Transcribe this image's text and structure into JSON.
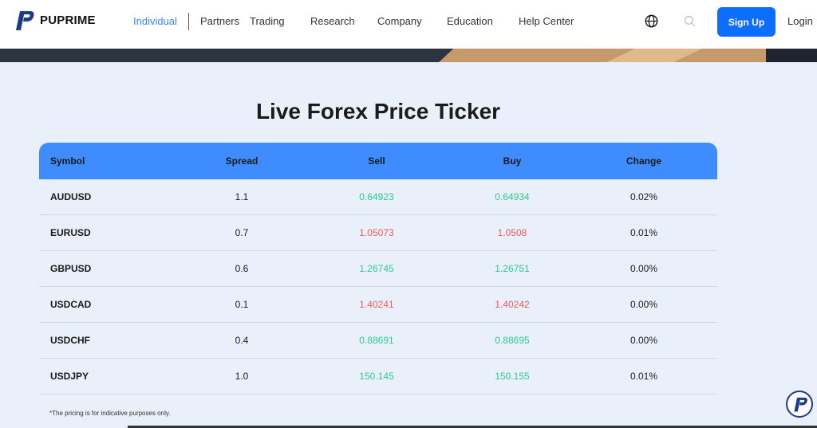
{
  "nav": {
    "brand": "PUPRIME",
    "links": [
      "Individual",
      "Partners",
      "Trading",
      "Research",
      "Company",
      "Education",
      "Help Center"
    ],
    "signup": "Sign Up",
    "login": "Login"
  },
  "colors": {
    "accent": "#0d6efd",
    "header": "#3f8cff",
    "up": "#2ec990",
    "down": "#ef5a5a",
    "background": "#e9f0fa"
  },
  "page": {
    "title": "Live Forex Price Ticker",
    "note": "*The pricing is for indicative purposes only."
  },
  "table": {
    "headers": {
      "symbol": "Symbol",
      "spread": "Spread",
      "sell": "Sell",
      "buy": "Buy",
      "change": "Change"
    },
    "rows": [
      {
        "symbol": "AUDUSD",
        "spread": "1.1",
        "sell": "0.64923",
        "buy": "0.64934",
        "change": "0.02%",
        "direction": "up"
      },
      {
        "symbol": "EURUSD",
        "spread": "0.7",
        "sell": "1.05073",
        "buy": "1.0508",
        "change": "0.01%",
        "direction": "down"
      },
      {
        "symbol": "GBPUSD",
        "spread": "0.6",
        "sell": "1.26745",
        "buy": "1.26751",
        "change": "0.00%",
        "direction": "up"
      },
      {
        "symbol": "USDCAD",
        "spread": "0.1",
        "sell": "1.40241",
        "buy": "1.40242",
        "change": "0.00%",
        "direction": "down"
      },
      {
        "symbol": "USDCHF",
        "spread": "0.4",
        "sell": "0.88691",
        "buy": "0.88695",
        "change": "0.00%",
        "direction": "up"
      },
      {
        "symbol": "USDJPY",
        "spread": "1.0",
        "sell": "150.145",
        "buy": "150.155",
        "change": "0.01%",
        "direction": "up"
      }
    ]
  },
  "icons": {
    "logo": "puprime-logo-icon",
    "globe": "globe-icon",
    "search": "search-icon",
    "chat": "chat-widget-icon"
  }
}
